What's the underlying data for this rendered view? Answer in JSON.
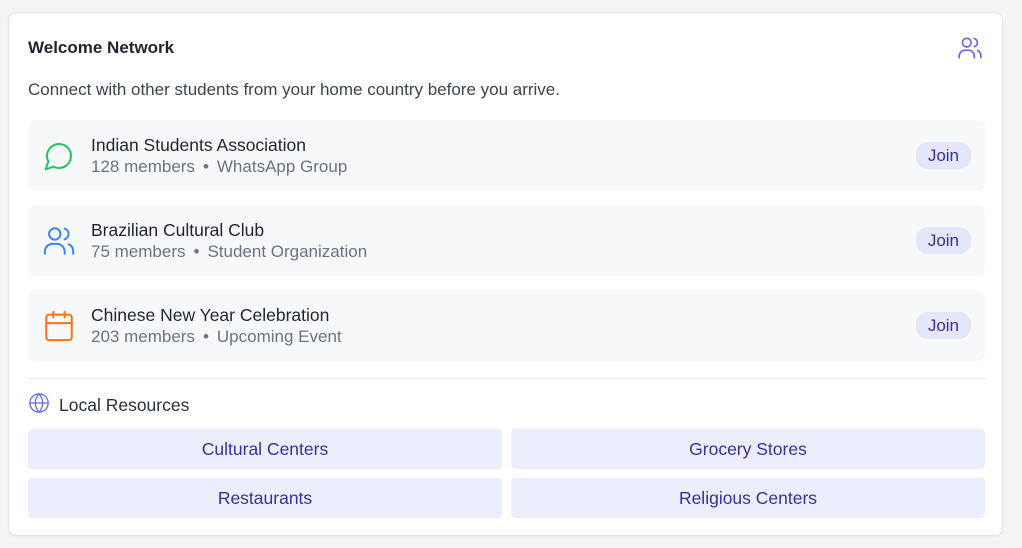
{
  "header": {
    "title": "Welcome Network",
    "subtitle": "Connect with other students from your home country before you arrive."
  },
  "groups": [
    {
      "name": "Indian Students Association",
      "members": "128 members",
      "separator": "•",
      "type": "WhatsApp Group",
      "icon": "message-circle-icon",
      "icon_color": "#22c55e",
      "action": "Join"
    },
    {
      "name": "Brazilian Cultural Club",
      "members": "75 members",
      "separator": "•",
      "type": "Student Organization",
      "icon": "users-icon",
      "icon_color": "#3b82f6",
      "action": "Join"
    },
    {
      "name": "Chinese New Year Celebration",
      "members": "203 members",
      "separator": "•",
      "type": "Upcoming Event",
      "icon": "calendar-icon",
      "icon_color": "#f97316",
      "action": "Join"
    }
  ],
  "resources": {
    "heading": "Local Resources",
    "icon": "globe-icon",
    "items": [
      "Cultural Centers",
      "Grocery Stores",
      "Restaurants",
      "Religious Centers"
    ]
  },
  "colors": {
    "accent": "#3730a3",
    "accent_bg": "#e4e7fb",
    "header_icon": "#6366f1"
  }
}
